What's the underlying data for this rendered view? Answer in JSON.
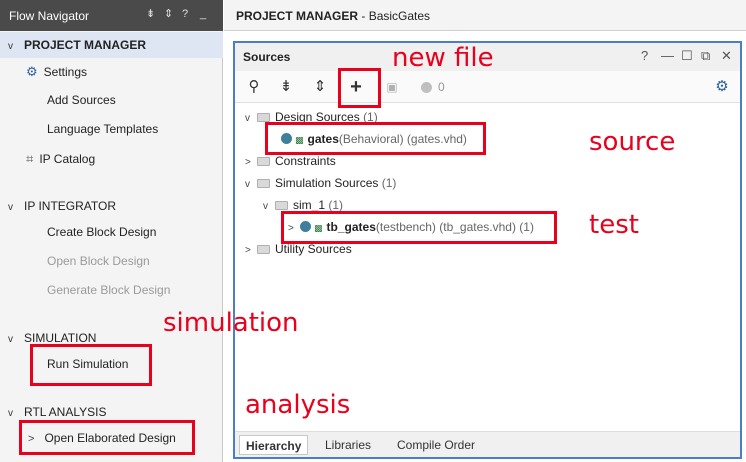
{
  "flow_navigator": {
    "title": "Flow Navigator",
    "header_icons": [
      "collapse-all-icon",
      "expand-icon",
      "help-icon",
      "minimize-icon"
    ],
    "sections": {
      "project_manager": {
        "label": "PROJECT MANAGER",
        "items": [
          "Settings",
          "Add Sources",
          "Language Templates",
          "IP Catalog"
        ]
      },
      "ip_integrator": {
        "label": "IP INTEGRATOR",
        "items": [
          "Create Block Design",
          "Open Block Design",
          "Generate Block Design"
        ]
      },
      "simulation": {
        "label": "SIMULATION",
        "items": [
          "Run Simulation"
        ]
      },
      "rtl_analysis": {
        "label": "RTL ANALYSIS",
        "items": [
          "Open Elaborated Design"
        ]
      }
    }
  },
  "topbar": {
    "section": "PROJECT MANAGER",
    "separator": " - ",
    "project": "BasicGates"
  },
  "sources": {
    "title": "Sources",
    "window_controls": [
      "?",
      "—",
      "☐",
      "⧉",
      "✕"
    ],
    "toolbar": {
      "count": "0"
    },
    "tree": {
      "design_sources": {
        "label": "Design Sources",
        "count": "(1)"
      },
      "gates": {
        "name": "gates",
        "detail": "(Behavioral) (gates.vhd)"
      },
      "constraints": {
        "label": "Constraints"
      },
      "simulation_sources": {
        "label": "Simulation Sources",
        "count": "(1)"
      },
      "sim_1": {
        "label": "sim_1",
        "count": "(1)"
      },
      "tb_gates": {
        "name": "tb_gates",
        "detail": "(testbench) (tb_gates.vhd) (1)"
      },
      "utility_sources": {
        "label": "Utility Sources"
      }
    },
    "tabs": [
      "Hierarchy",
      "Libraries",
      "Compile Order"
    ],
    "active_tab": "Hierarchy"
  },
  "annotations": {
    "new_file": "new file",
    "source": "source",
    "test": "test",
    "simulation": "simulation",
    "analysis": "analysis",
    "color": "#e8001c"
  },
  "colors": {
    "header_dark": "#4a4a4a",
    "selected_row": "#dfe6f3",
    "panel_border": "#4a7fc6",
    "file_dot": "#3f7f9c"
  }
}
